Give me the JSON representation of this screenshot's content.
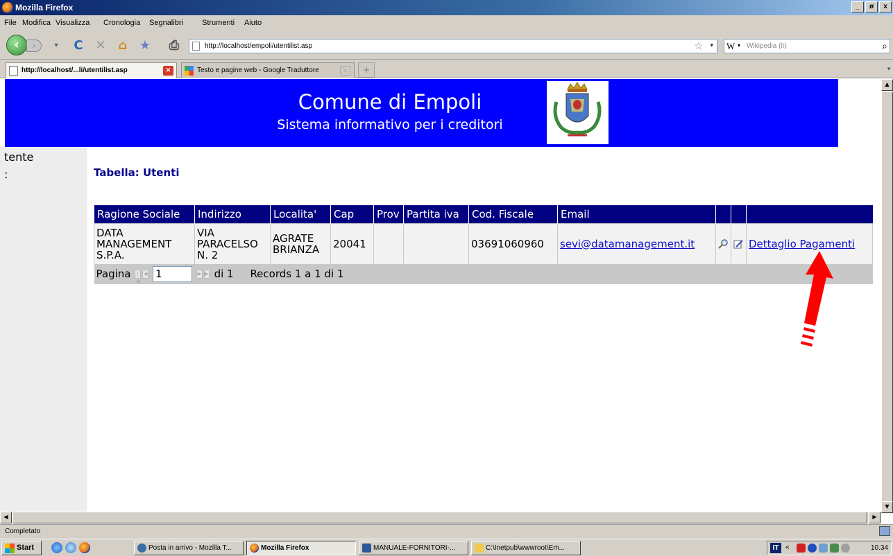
{
  "window": {
    "title": "Mozilla Firefox",
    "controls": [
      "_",
      "ø",
      "x"
    ]
  },
  "menu": [
    "File",
    "Modifica",
    "Visualizza",
    "Cronologia",
    "Segnalibri",
    "Strumenti",
    "Aiuto"
  ],
  "nav": {
    "url": "http://localhost/empoli/utentilist.asp",
    "search_placeholder": "Wikipedia (it)",
    "search_engine": "W"
  },
  "tabs": [
    {
      "label": "http://localhost/...li/utentilist.asp",
      "active": true
    },
    {
      "label": "Testo e pagine web - Google Traduttore",
      "active": false
    }
  ],
  "page": {
    "banner_title": "Comune di Empoli",
    "banner_subtitle": "Sistema informativo per i creditori",
    "left_text_1": "tente",
    "left_text_2": ":",
    "table_title": "Tabella: Utenti",
    "columns": [
      "Ragione Sociale",
      "Indirizzo",
      "Localita'",
      "Cap",
      "Prov",
      "Partita iva",
      "Cod. Fiscale",
      "Email",
      "",
      "",
      ""
    ],
    "row": {
      "ragione_sociale": "DATA MANAGEMENT S.P.A.",
      "indirizzo": "VIA PARACELSO N. 2",
      "localita": "AGRATE BRIANZA",
      "cap": "20041",
      "prov": "",
      "partita_iva": "",
      "cod_fiscale": "03691060960",
      "email": "sevi@datamanagement.it",
      "dettaglio": "Dettaglio Pagamenti"
    },
    "pager": {
      "label": "Pagina",
      "page": "1",
      "of": "di 1",
      "records": "Records 1 a 1 di 1"
    }
  },
  "status": "Completato",
  "taskbar": {
    "start": "Start",
    "tasks": [
      {
        "label": "Posta in arrivo - Mozilla T...",
        "active": false
      },
      {
        "label": "Mozilla Firefox",
        "active": true
      },
      {
        "label": "MANUALE-FORNITORI-...",
        "active": false
      },
      {
        "label": "C:\\Inetpub\\wwwroot\\Em...",
        "active": false
      }
    ],
    "lang": "IT",
    "clock": "10.34"
  },
  "colors": {
    "banner": "#0000ff",
    "header_bg": "#000080",
    "arrow": "#ff0000",
    "link": "#1010cc"
  }
}
